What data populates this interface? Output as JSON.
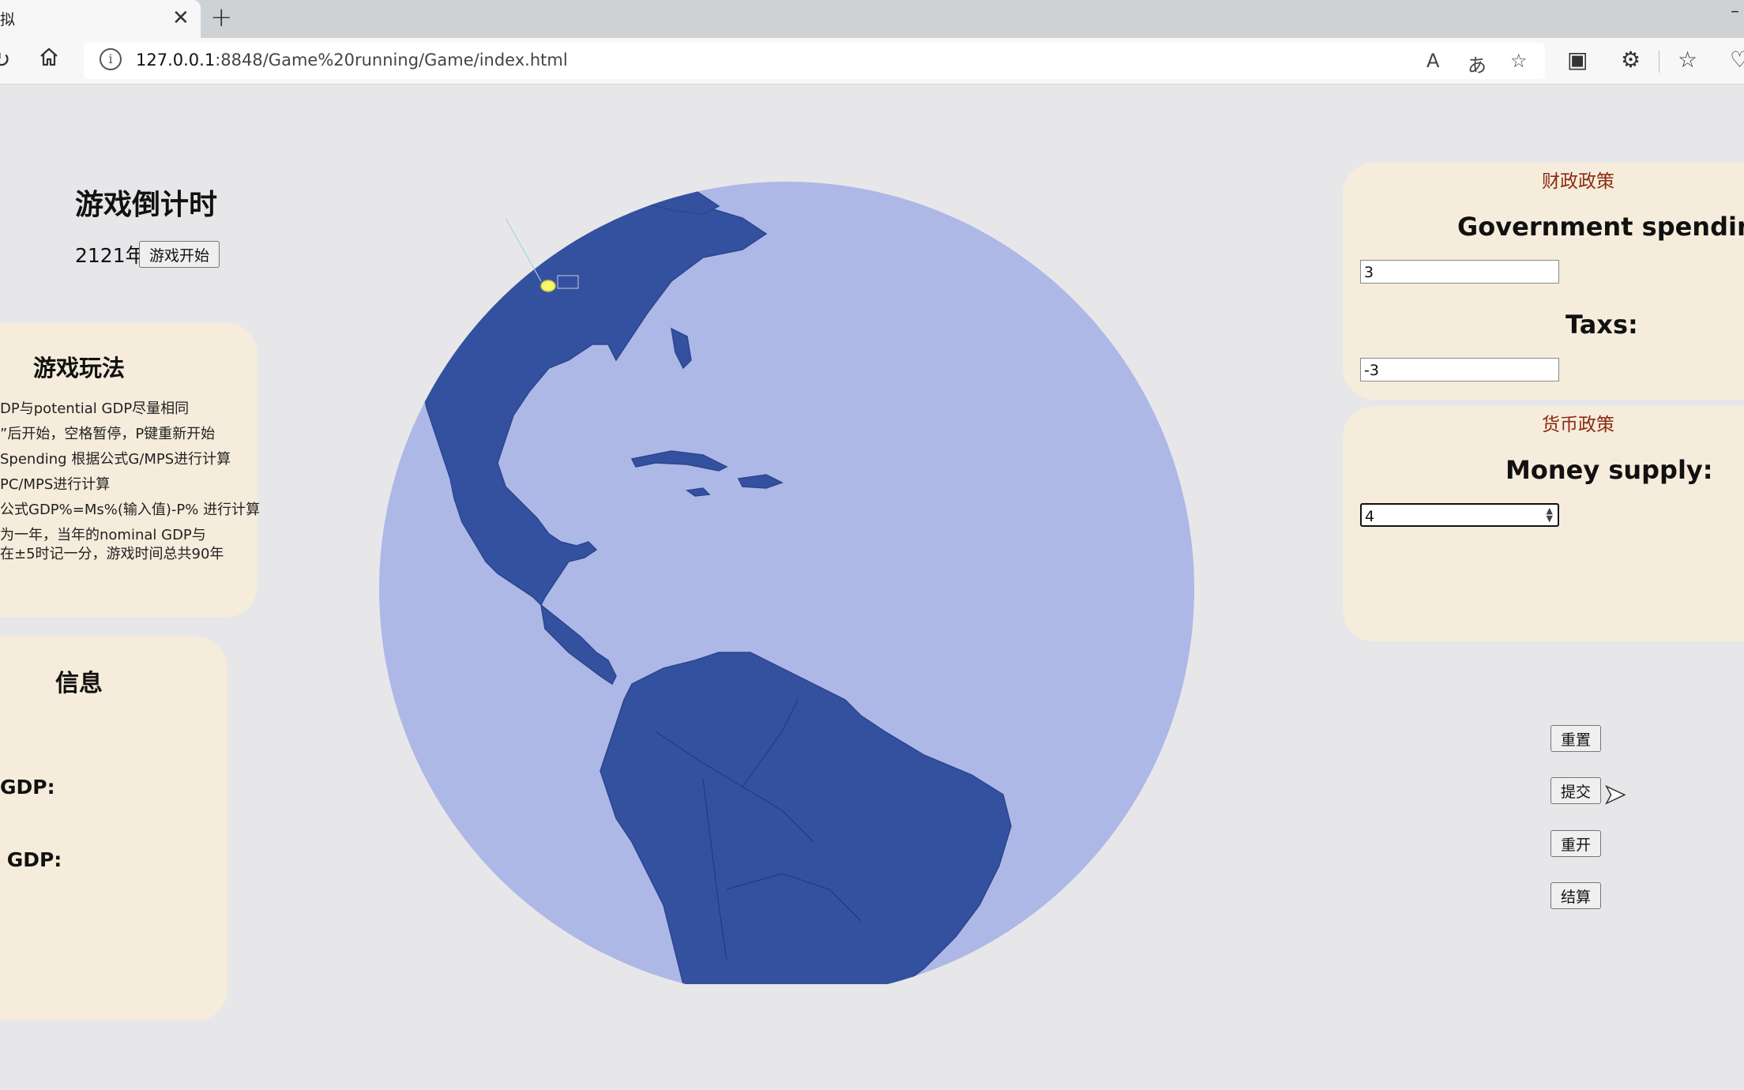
{
  "browser": {
    "tab_title": "拟",
    "tab_close": "✕",
    "new_tab": "+",
    "url_host": "127.0.0.1",
    "url_rest": ":8848/Game%20running/Game/index.html",
    "icons": [
      "refresh-icon",
      "home-icon",
      "site-info-icon",
      "read-aloud-icon",
      "translate-icon",
      "favorite-add-icon",
      "collections-icon",
      "extensions-icon",
      "favorites-icon",
      "browser-essentials-icon"
    ]
  },
  "countdown": {
    "title": "游戏倒计时",
    "year": "2121年",
    "start_button": "游戏开始"
  },
  "gameplay": {
    "title": "游戏玩法",
    "rules": [
      "DP与potential GDP尽量相同",
      "”后开始，空格暂停，P键重新开始",
      " Spending 根据公式G/MPS进行计算",
      "PC/MPS进行计算",
      "公式GDP%=Ms%(输入值)-P% 进行计算",
      "为一年，当年的nominal GDP与",
      "在±5时记一分，游戏时间总共90年"
    ]
  },
  "info": {
    "title": "信息",
    "label_1": "GDP:",
    "label_2": " GDP:"
  },
  "fiscal": {
    "title": "财政政策",
    "gov_label": "Government spending:",
    "gov_value": "3",
    "tax_label": "Taxs:",
    "tax_value": "-3"
  },
  "monetary": {
    "title": "货币政策",
    "money_label": "Money supply:",
    "money_value": "4"
  },
  "buttons": {
    "reset": "重置",
    "submit": "提交",
    "restart": "重开",
    "settle": "结算"
  },
  "colors": {
    "ocean": "#adb8e6",
    "land": "#3451a0",
    "panel": "#f6ecdc",
    "section_title": "#8b2b12",
    "page_bg": "#e7e7ea"
  }
}
